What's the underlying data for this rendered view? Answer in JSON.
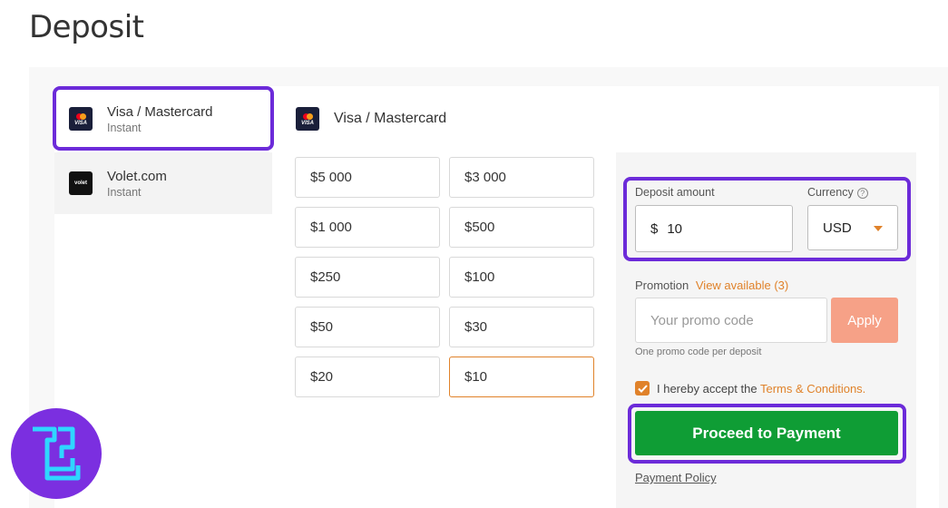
{
  "page": {
    "title": "Deposit"
  },
  "sidebar": {
    "items": [
      {
        "name": "Visa / Mastercard",
        "sub": "Instant",
        "logo": "visa-mastercard-logo"
      },
      {
        "name": "Volet.com",
        "sub": "Instant",
        "logo": "volet-logo",
        "logo_text": "volet"
      }
    ]
  },
  "main": {
    "method_title": "Visa / Mastercard",
    "logo_text": "VISA",
    "amounts": [
      "$5 000",
      "$3 000",
      "$1 000",
      "$500",
      "$250",
      "$100",
      "$50",
      "$30",
      "$20",
      "$10"
    ],
    "selected_amount": "$10"
  },
  "deposit": {
    "amount_label": "Deposit amount",
    "currency_symbol": "$",
    "amount_value": "10",
    "currency_label": "Currency",
    "currency_value": "USD",
    "info_glyph": "?"
  },
  "promo": {
    "label": "Promotion",
    "view_link": "View available (3)",
    "placeholder": "Your promo code",
    "apply_label": "Apply",
    "hint": "One promo code per deposit"
  },
  "terms": {
    "checked": true,
    "text": "I hereby accept the",
    "link": "Terms & Conditions."
  },
  "actions": {
    "proceed_label": "Proceed to Payment",
    "policy_label": "Payment Policy"
  },
  "colors": {
    "accent": "#e0822a",
    "highlight": "#6c2bd9",
    "proceed": "#0f9d35",
    "apply": "#f6a187",
    "brand_bg": "#7b2fe0",
    "brand_fg": "#2fd6ff"
  }
}
